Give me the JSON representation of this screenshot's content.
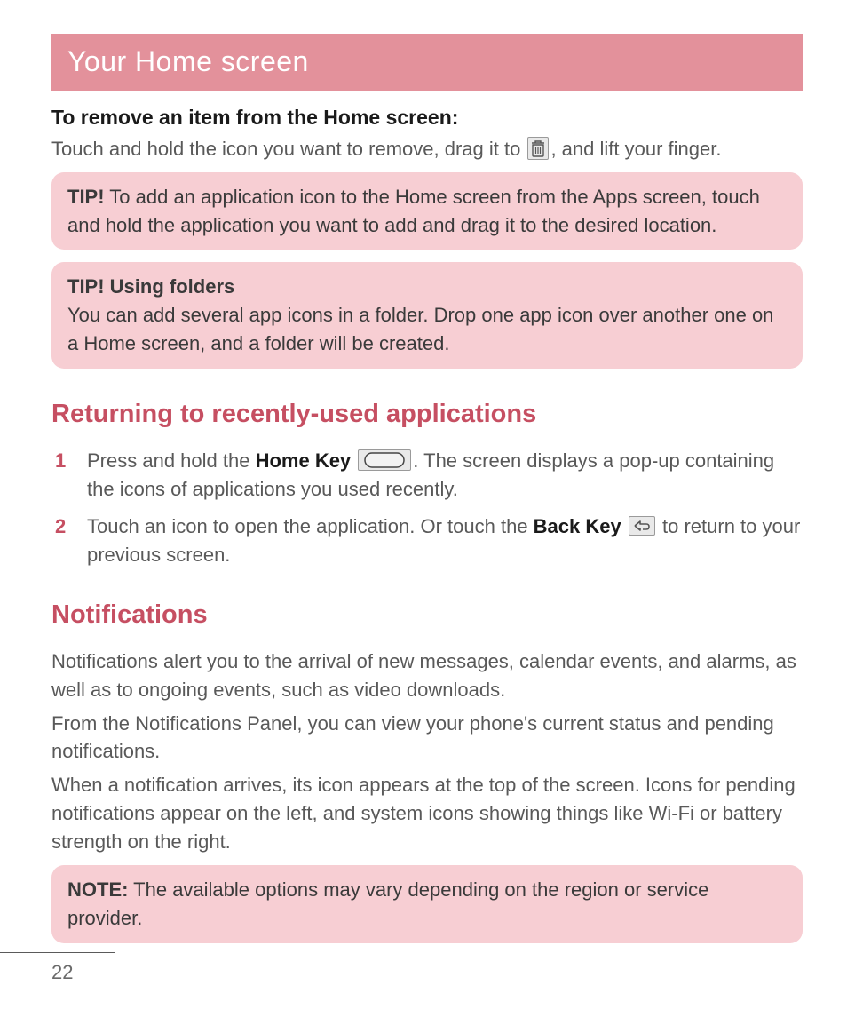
{
  "banner": {
    "title": "Your Home screen"
  },
  "remove": {
    "heading": "To remove an item from the Home screen:",
    "line_a": "Touch and hold the icon you want to remove, drag it to ",
    "line_b": ", and lift your finger."
  },
  "tip1": {
    "label": "TIP!",
    "text": " To add an application icon to the Home screen from the Apps screen, touch and hold the application you want to add and drag it to the desired location."
  },
  "tip2": {
    "label": "TIP! Using folders",
    "text": "You can add several app icons in a folder. Drop one app icon over another one on a Home screen, and a folder will be created."
  },
  "returning": {
    "heading": "Returning to recently-used applications",
    "step1_a": "Press and hold the ",
    "step1_key": "Home Key",
    "step1_b": ". The screen displays a pop-up containing the icons of applications you used recently.",
    "step2_a": "Touch an icon to open the application. Or touch the ",
    "step2_key": "Back Key",
    "step2_b": " to return to your previous screen."
  },
  "notifications": {
    "heading": "Notifications",
    "p1": "Notifications alert you to the arrival of new messages, calendar events, and alarms, as well as to ongoing events, such as video downloads.",
    "p2": "From the Notifications Panel, you can view your phone's current status and pending notifications.",
    "p3": "When a notification arrives, its icon appears at the top of the screen. Icons for pending notifications appear on the left, and system icons showing things like Wi-Fi or battery strength on the right."
  },
  "note_box": {
    "label": "NOTE:",
    "text": " The available options may vary depending on the region or service provider."
  },
  "page": {
    "number": "22"
  }
}
